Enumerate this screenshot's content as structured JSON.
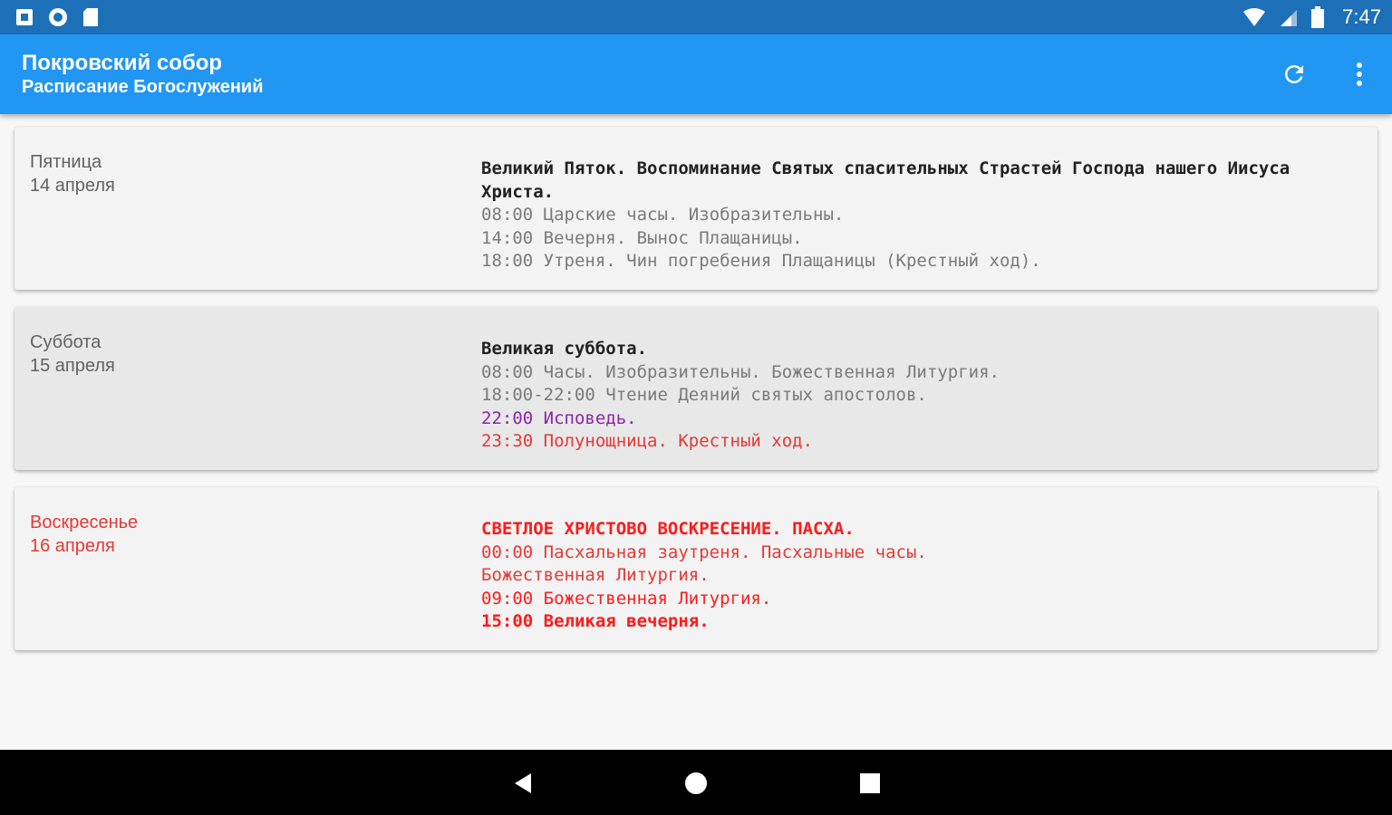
{
  "statusbar": {
    "time": "7:47",
    "left_icons": [
      "notification-square-icon",
      "sync-circle-icon",
      "sd-card-icon"
    ],
    "right_icons": [
      "wifi-icon",
      "cell-signal-icon",
      "battery-icon"
    ]
  },
  "appbar": {
    "title": "Покровский собор",
    "subtitle": "Расписание Богослужений",
    "actions": [
      "refresh-icon",
      "more-vertical-icon"
    ],
    "background": "#2196f3"
  },
  "colors": {
    "statusbar": "#1d70b8",
    "text_gray": "#7a7a7a",
    "text_dark": "#212121",
    "purple": "#8e24aa",
    "red": "#ff1a1a",
    "pink_red": "#e53935"
  },
  "days": [
    {
      "weekday": "Пятница",
      "date": "14 апреля",
      "lines": [
        {
          "text": "Великий Пяток. Воспоминание Святых спасительных Страстей Господа нашего Иисуса Христа.",
          "style": "title"
        },
        {
          "text": "08:00 Царские часы. Изобразительны.",
          "style": ""
        },
        {
          "text": "14:00 Вечерня. Вынос Плащаницы.",
          "style": ""
        },
        {
          "text": "18:00 Утреня. Чин погребения Плащаницы (Крестный ход).",
          "style": ""
        }
      ]
    },
    {
      "weekday": "Суббота",
      "date": "15 апреля",
      "lines": [
        {
          "text": "Великая суббота.",
          "style": "title"
        },
        {
          "text": "08:00 Часы. Изобразительны. Божественная Литургия.",
          "style": ""
        },
        {
          "text": "18:00-22:00 Чтение Деяний святых апостолов.",
          "style": ""
        },
        {
          "text": "22:00 Исповедь.",
          "style": "purple"
        },
        {
          "text": "23:30 Полунощница. Крестный ход.",
          "style": "pink"
        }
      ]
    },
    {
      "weekday": "Воскресенье",
      "date": "16 апреля",
      "lines": [
        {
          "text": "СВЕТЛОЕ ХРИСТОВО ВОСКРЕСЕНИЕ. ПАСХА.",
          "style": "red bold"
        },
        {
          "text": "00:00 Пасхальная заутреня. Пасхальные часы.",
          "style": "pink"
        },
        {
          "text": "Божественная Литургия.",
          "style": "pink"
        },
        {
          "text": "09:00 Божественная Литургия.",
          "style": "red"
        },
        {
          "text": "15:00 Великая вечерня.",
          "style": "red bold"
        }
      ]
    }
  ],
  "navbar": {
    "buttons": [
      "back-triangle-icon",
      "home-circle-icon",
      "recents-square-icon"
    ]
  }
}
